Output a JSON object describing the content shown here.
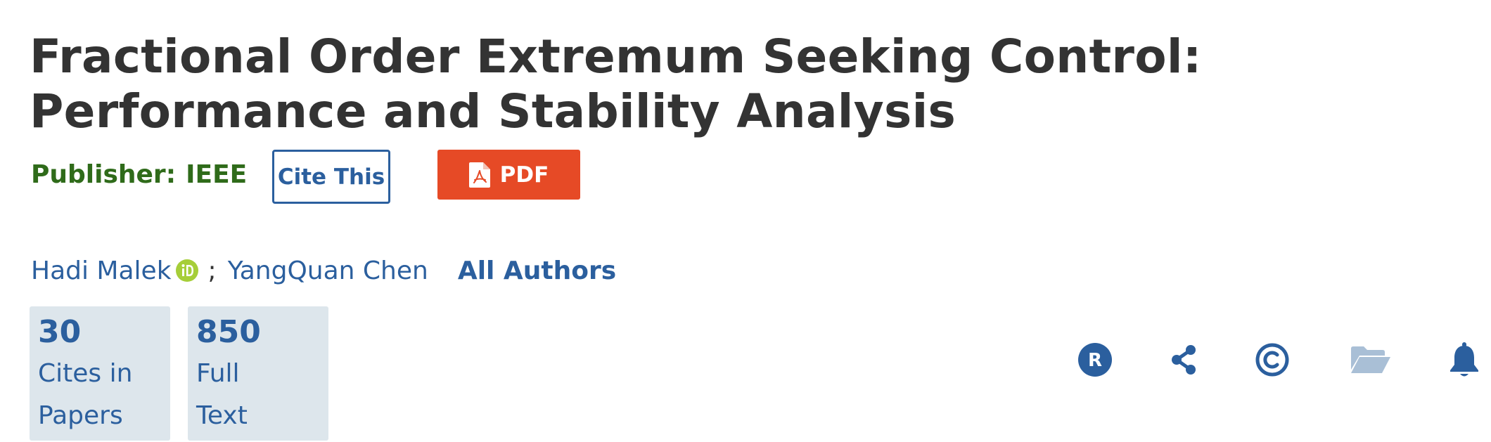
{
  "article": {
    "title": "Fractional Order Extremum Seeking Control: Performance and Stability Analysis",
    "publisher_label": "Publisher:",
    "publisher_value": "IEEE"
  },
  "actions": {
    "cite_label": "Cite This",
    "pdf_label": "PDF"
  },
  "authors": {
    "items": [
      {
        "name": "Hadi Malek",
        "orcid": true
      },
      {
        "name": "YangQuan Chen",
        "orcid": false
      }
    ],
    "separator": ";",
    "all_authors_label": "All Authors"
  },
  "metrics": [
    {
      "value": "30",
      "label_line1": "Cites in",
      "label_line2": "Papers"
    },
    {
      "value": "850",
      "label_line1": "Full",
      "label_line2": "Text"
    }
  ],
  "toolbar": {
    "icons": [
      "rights-r-icon",
      "share-icon",
      "copyright-icon",
      "folder-icon",
      "bell-icon"
    ]
  },
  "colors": {
    "link_blue": "#2b5f9e",
    "title_text": "#333333",
    "publisher_green": "#2f6b1a",
    "pdf_orange": "#e64a26",
    "metric_bg": "#dde6ec",
    "orcid_green": "#a6ce39",
    "folder_disabled": "#a9bfd6"
  }
}
